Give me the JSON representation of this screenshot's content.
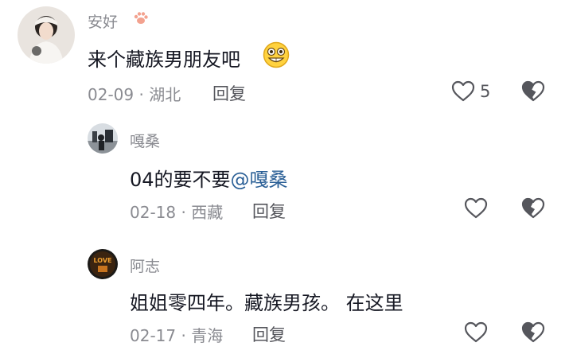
{
  "comments": [
    {
      "username": "安好",
      "text": "来个藏族男朋友吧",
      "date": "02-09",
      "location": "湖北",
      "reply_label": "回复",
      "like_count": "5"
    },
    {
      "username": "嘎桑",
      "text": "04的要不要",
      "mention": "@嘎桑",
      "date": "02-18",
      "location": "西藏",
      "reply_label": "回复"
    },
    {
      "username": "阿志",
      "text": "姐姐零四年。藏族男孩。 在这里",
      "date": "02-17",
      "location": "青海",
      "reply_label": "回复",
      "avatar_text": "LOVE"
    }
  ],
  "meta_separator": "·",
  "colors": {
    "secondary_text": "#8a8b91",
    "primary_text": "#161823",
    "mention": "#2a5f96"
  },
  "icons": [
    "paw-icon",
    "grinning-emoji-icon",
    "heart-icon",
    "broken-heart-icon"
  ]
}
